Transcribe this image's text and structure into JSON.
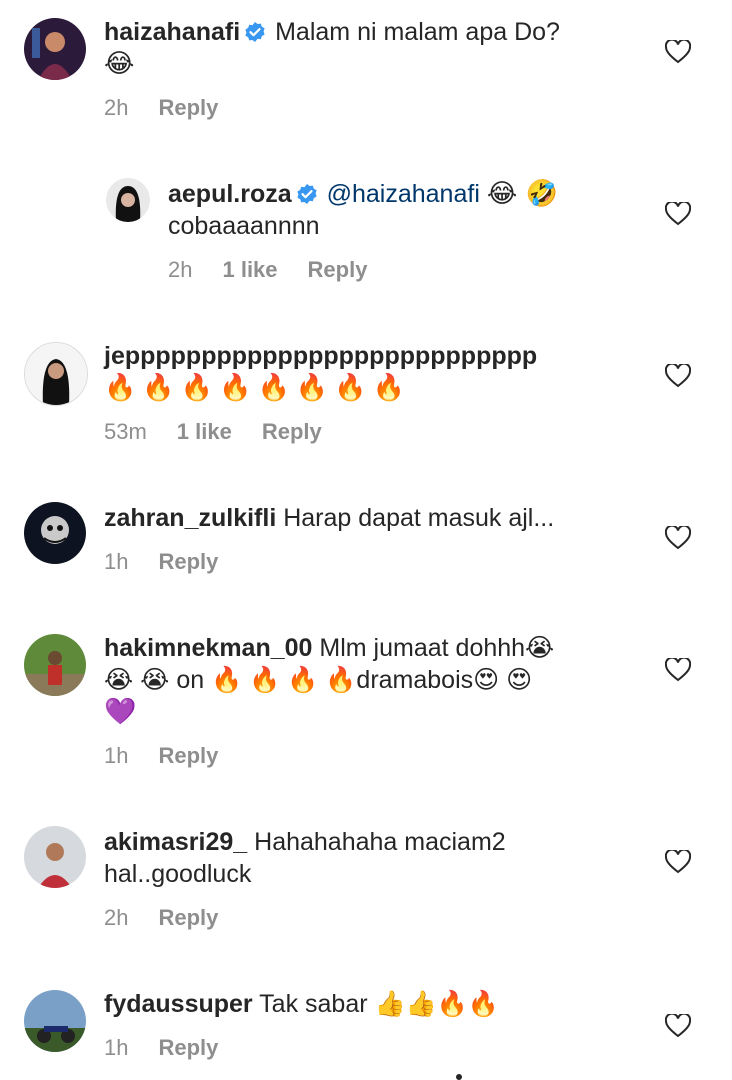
{
  "comments": [
    {
      "username": "haizahanafi",
      "verified": true,
      "text": "Malam ni malam apa Do?",
      "emoji_line2": "😂",
      "time": "2h",
      "likes": "",
      "reply": "Reply"
    },
    {
      "username": "aepul.roza",
      "verified": true,
      "mention": "@haizahanafi",
      "emoji_after_mention": "😂 🤣",
      "text_line2": "cobaaaannnn",
      "time": "2h",
      "likes": "1 like",
      "reply": "Reply"
    },
    {
      "username": "jeppppppppppppppppppppppppppp",
      "verified": false,
      "emoji_line2": "🔥🔥🔥🔥🔥🔥🔥🔥",
      "time": "53m",
      "likes": "1 like",
      "reply": "Reply"
    },
    {
      "username": "zahran_zulkifli",
      "verified": false,
      "text": "Harap dapat masuk ajl...",
      "time": "1h",
      "likes": "",
      "reply": "Reply"
    },
    {
      "username": "hakimnekman_00",
      "verified": false,
      "text": "Mlm jumaat dohhh😭",
      "text_line2": "😭 😭 on  🔥 🔥 🔥 🔥dramabois😍 😍",
      "emoji_line3": "💜",
      "time": "1h",
      "likes": "",
      "reply": "Reply"
    },
    {
      "username": "akimasri29_",
      "verified": false,
      "text": "Hahahahaha maciam2",
      "text_line2": "hal..goodluck",
      "time": "2h",
      "likes": "",
      "reply": "Reply"
    },
    {
      "username": "fydaussuper",
      "verified": false,
      "text": "Tak sabar 👍👍🔥🔥",
      "time": "1h",
      "likes": "",
      "reply": "Reply"
    }
  ],
  "icons": {
    "verified": "verified-badge-icon",
    "like": "heart-outline-icon"
  },
  "colors": {
    "text": "#262626",
    "meta": "#8e8e8e",
    "verified": "#3897f0",
    "mention": "#00376b"
  }
}
